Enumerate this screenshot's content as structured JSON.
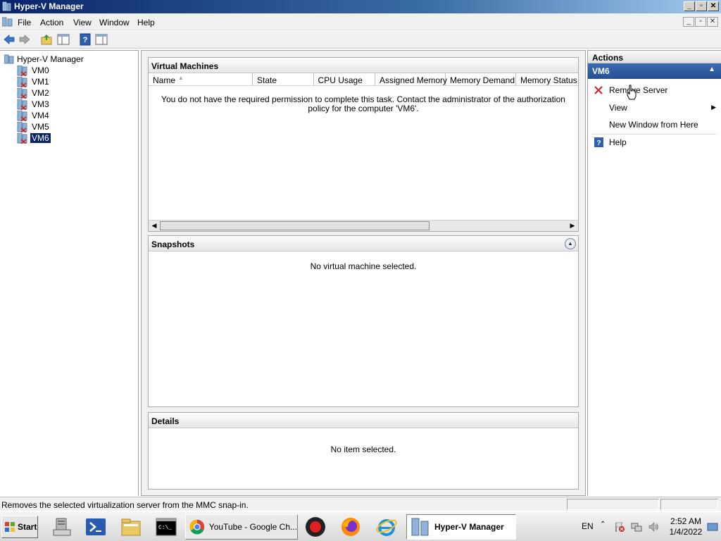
{
  "window": {
    "title": "Hyper-V Manager"
  },
  "menu": [
    "File",
    "Action",
    "View",
    "Window",
    "Help"
  ],
  "tree": {
    "root": "Hyper-V Manager",
    "nodes": [
      "VM0",
      "VM1",
      "VM2",
      "VM3",
      "VM4",
      "VM5",
      "VM6"
    ],
    "selected": "VM6"
  },
  "vm_panel": {
    "title": "Virtual Machines",
    "columns": [
      "Name",
      "State",
      "CPU Usage",
      "Assigned Memory",
      "Memory Demand",
      "Memory Status"
    ],
    "message": "You do not have the required permission to complete this task. Contact the administrator of the authorization policy for the computer 'VM6'."
  },
  "snapshots_panel": {
    "title": "Snapshots",
    "message": "No virtual machine selected."
  },
  "details_panel": {
    "title": "Details",
    "message": "No item selected."
  },
  "actions": {
    "title": "Actions",
    "section": "VM6",
    "items": [
      {
        "label": "Remove Server",
        "icon": "red-x-icon"
      },
      {
        "label": "View",
        "icon": ""
      },
      {
        "label": "New Window from Here",
        "icon": ""
      },
      {
        "label": "Help",
        "icon": "help-icon"
      }
    ]
  },
  "status": {
    "text": "Removes the selected virtualization server from the MMC snap-in."
  },
  "taskbar": {
    "start": "Start",
    "chrome_label": "YouTube - Google Ch...",
    "hyperv_label": "Hyper-V Manager",
    "lang": "EN",
    "time": "2:52 AM",
    "date": "1/4/2022"
  }
}
